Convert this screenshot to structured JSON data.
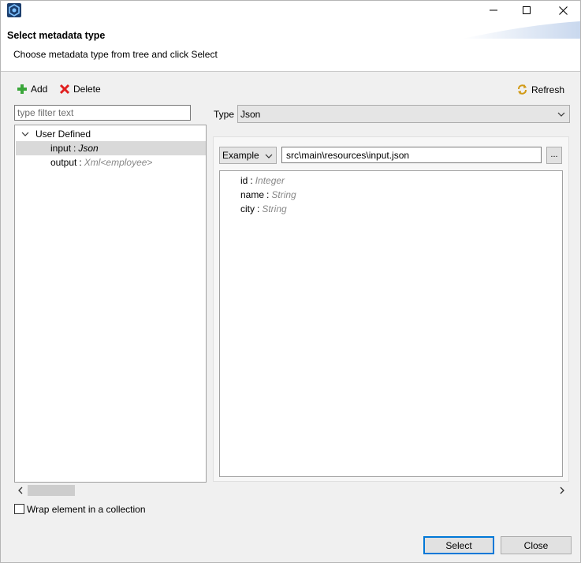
{
  "window": {
    "app_icon": "eclipse-app-icon",
    "controls": {
      "minimize": "minimize-icon",
      "maximize": "maximize-icon",
      "close": "close-icon"
    }
  },
  "header": {
    "title": "Select metadata type",
    "message": "Choose metadata type from tree and click Select"
  },
  "toolbar": {
    "add_label": "Add",
    "delete_label": "Delete",
    "refresh_label": "Refresh",
    "add_icon": "plus-icon",
    "delete_icon": "red-x-icon",
    "refresh_icon": "refresh-icon"
  },
  "filter": {
    "placeholder": "type filter text",
    "value": ""
  },
  "tree": {
    "root": {
      "label": "User Defined",
      "expanded": true
    },
    "items": [
      {
        "name": "input",
        "type": "Json",
        "selected": true
      },
      {
        "name": "output",
        "type": "Xml<employee>",
        "selected": false
      }
    ]
  },
  "type_field": {
    "label": "Type",
    "selected": "Json"
  },
  "source": {
    "mode": "Example",
    "path": "src\\main\\resources\\input.json",
    "browse_label": "..."
  },
  "fields": [
    {
      "name": "id",
      "type": "Integer"
    },
    {
      "name": "name",
      "type": "String"
    },
    {
      "name": "city",
      "type": "String"
    }
  ],
  "wrap_collection": {
    "label": "Wrap element in a collection",
    "checked": false
  },
  "buttons": {
    "select": "Select",
    "close": "Close"
  },
  "colors": {
    "accent": "#0078d7",
    "selection": "#d9d9d9",
    "type_gray": "#888888",
    "delete_red": "#e02020",
    "add_green": "#3aa63a"
  }
}
